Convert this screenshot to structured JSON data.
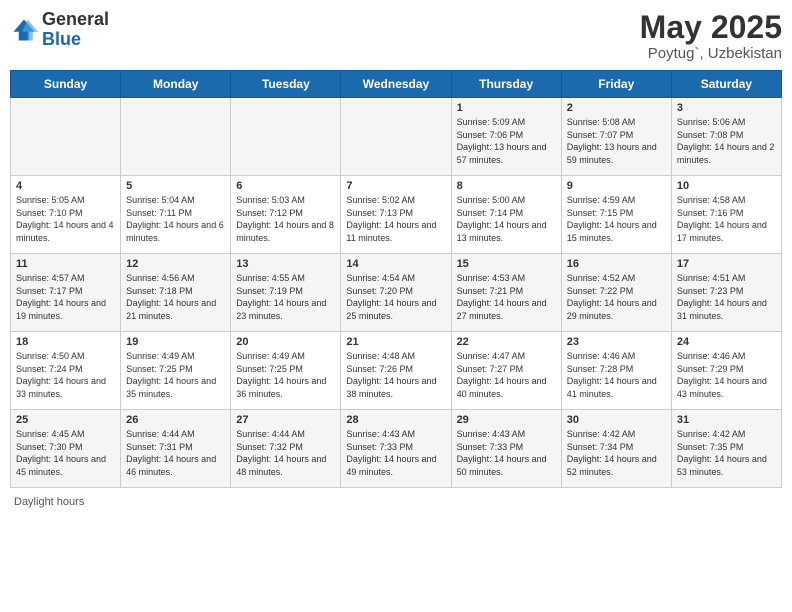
{
  "header": {
    "logo_general": "General",
    "logo_blue": "Blue",
    "month": "May 2025",
    "location": "Poytug`, Uzbekistan"
  },
  "days_of_week": [
    "Sunday",
    "Monday",
    "Tuesday",
    "Wednesday",
    "Thursday",
    "Friday",
    "Saturday"
  ],
  "weeks": [
    [
      {
        "day": "",
        "sunrise": "",
        "sunset": "",
        "daylight": ""
      },
      {
        "day": "",
        "sunrise": "",
        "sunset": "",
        "daylight": ""
      },
      {
        "day": "",
        "sunrise": "",
        "sunset": "",
        "daylight": ""
      },
      {
        "day": "",
        "sunrise": "",
        "sunset": "",
        "daylight": ""
      },
      {
        "day": "1",
        "sunrise": "Sunrise: 5:09 AM",
        "sunset": "Sunset: 7:06 PM",
        "daylight": "Daylight: 13 hours and 57 minutes."
      },
      {
        "day": "2",
        "sunrise": "Sunrise: 5:08 AM",
        "sunset": "Sunset: 7:07 PM",
        "daylight": "Daylight: 13 hours and 59 minutes."
      },
      {
        "day": "3",
        "sunrise": "Sunrise: 5:06 AM",
        "sunset": "Sunset: 7:08 PM",
        "daylight": "Daylight: 14 hours and 2 minutes."
      }
    ],
    [
      {
        "day": "4",
        "sunrise": "Sunrise: 5:05 AM",
        "sunset": "Sunset: 7:10 PM",
        "daylight": "Daylight: 14 hours and 4 minutes."
      },
      {
        "day": "5",
        "sunrise": "Sunrise: 5:04 AM",
        "sunset": "Sunset: 7:11 PM",
        "daylight": "Daylight: 14 hours and 6 minutes."
      },
      {
        "day": "6",
        "sunrise": "Sunrise: 5:03 AM",
        "sunset": "Sunset: 7:12 PM",
        "daylight": "Daylight: 14 hours and 8 minutes."
      },
      {
        "day": "7",
        "sunrise": "Sunrise: 5:02 AM",
        "sunset": "Sunset: 7:13 PM",
        "daylight": "Daylight: 14 hours and 11 minutes."
      },
      {
        "day": "8",
        "sunrise": "Sunrise: 5:00 AM",
        "sunset": "Sunset: 7:14 PM",
        "daylight": "Daylight: 14 hours and 13 minutes."
      },
      {
        "day": "9",
        "sunrise": "Sunrise: 4:59 AM",
        "sunset": "Sunset: 7:15 PM",
        "daylight": "Daylight: 14 hours and 15 minutes."
      },
      {
        "day": "10",
        "sunrise": "Sunrise: 4:58 AM",
        "sunset": "Sunset: 7:16 PM",
        "daylight": "Daylight: 14 hours and 17 minutes."
      }
    ],
    [
      {
        "day": "11",
        "sunrise": "Sunrise: 4:57 AM",
        "sunset": "Sunset: 7:17 PM",
        "daylight": "Daylight: 14 hours and 19 minutes."
      },
      {
        "day": "12",
        "sunrise": "Sunrise: 4:56 AM",
        "sunset": "Sunset: 7:18 PM",
        "daylight": "Daylight: 14 hours and 21 minutes."
      },
      {
        "day": "13",
        "sunrise": "Sunrise: 4:55 AM",
        "sunset": "Sunset: 7:19 PM",
        "daylight": "Daylight: 14 hours and 23 minutes."
      },
      {
        "day": "14",
        "sunrise": "Sunrise: 4:54 AM",
        "sunset": "Sunset: 7:20 PM",
        "daylight": "Daylight: 14 hours and 25 minutes."
      },
      {
        "day": "15",
        "sunrise": "Sunrise: 4:53 AM",
        "sunset": "Sunset: 7:21 PM",
        "daylight": "Daylight: 14 hours and 27 minutes."
      },
      {
        "day": "16",
        "sunrise": "Sunrise: 4:52 AM",
        "sunset": "Sunset: 7:22 PM",
        "daylight": "Daylight: 14 hours and 29 minutes."
      },
      {
        "day": "17",
        "sunrise": "Sunrise: 4:51 AM",
        "sunset": "Sunset: 7:23 PM",
        "daylight": "Daylight: 14 hours and 31 minutes."
      }
    ],
    [
      {
        "day": "18",
        "sunrise": "Sunrise: 4:50 AM",
        "sunset": "Sunset: 7:24 PM",
        "daylight": "Daylight: 14 hours and 33 minutes."
      },
      {
        "day": "19",
        "sunrise": "Sunrise: 4:49 AM",
        "sunset": "Sunset: 7:25 PM",
        "daylight": "Daylight: 14 hours and 35 minutes."
      },
      {
        "day": "20",
        "sunrise": "Sunrise: 4:49 AM",
        "sunset": "Sunset: 7:25 PM",
        "daylight": "Daylight: 14 hours and 36 minutes."
      },
      {
        "day": "21",
        "sunrise": "Sunrise: 4:48 AM",
        "sunset": "Sunset: 7:26 PM",
        "daylight": "Daylight: 14 hours and 38 minutes."
      },
      {
        "day": "22",
        "sunrise": "Sunrise: 4:47 AM",
        "sunset": "Sunset: 7:27 PM",
        "daylight": "Daylight: 14 hours and 40 minutes."
      },
      {
        "day": "23",
        "sunrise": "Sunrise: 4:46 AM",
        "sunset": "Sunset: 7:28 PM",
        "daylight": "Daylight: 14 hours and 41 minutes."
      },
      {
        "day": "24",
        "sunrise": "Sunrise: 4:46 AM",
        "sunset": "Sunset: 7:29 PM",
        "daylight": "Daylight: 14 hours and 43 minutes."
      }
    ],
    [
      {
        "day": "25",
        "sunrise": "Sunrise: 4:45 AM",
        "sunset": "Sunset: 7:30 PM",
        "daylight": "Daylight: 14 hours and 45 minutes."
      },
      {
        "day": "26",
        "sunrise": "Sunrise: 4:44 AM",
        "sunset": "Sunset: 7:31 PM",
        "daylight": "Daylight: 14 hours and 46 minutes."
      },
      {
        "day": "27",
        "sunrise": "Sunrise: 4:44 AM",
        "sunset": "Sunset: 7:32 PM",
        "daylight": "Daylight: 14 hours and 48 minutes."
      },
      {
        "day": "28",
        "sunrise": "Sunrise: 4:43 AM",
        "sunset": "Sunset: 7:33 PM",
        "daylight": "Daylight: 14 hours and 49 minutes."
      },
      {
        "day": "29",
        "sunrise": "Sunrise: 4:43 AM",
        "sunset": "Sunset: 7:33 PM",
        "daylight": "Daylight: 14 hours and 50 minutes."
      },
      {
        "day": "30",
        "sunrise": "Sunrise: 4:42 AM",
        "sunset": "Sunset: 7:34 PM",
        "daylight": "Daylight: 14 hours and 52 minutes."
      },
      {
        "day": "31",
        "sunrise": "Sunrise: 4:42 AM",
        "sunset": "Sunset: 7:35 PM",
        "daylight": "Daylight: 14 hours and 53 minutes."
      }
    ]
  ],
  "footer": {
    "daylight_label": "Daylight hours"
  }
}
